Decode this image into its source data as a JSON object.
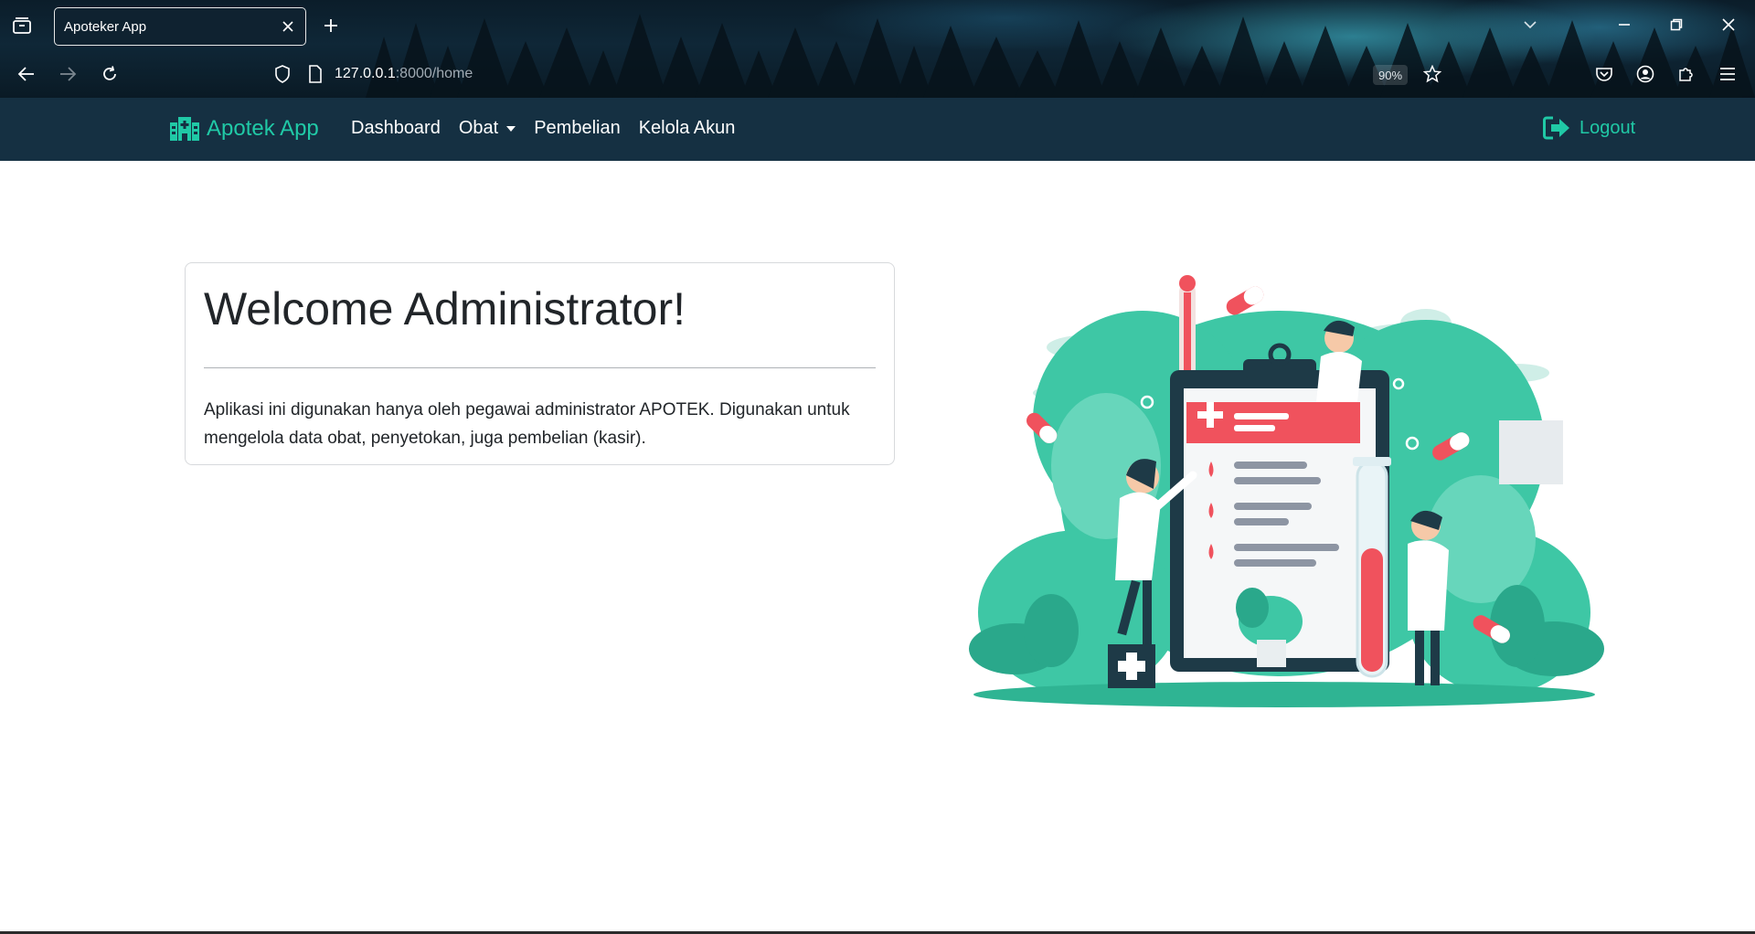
{
  "browser": {
    "tab_title": "Apoteker App",
    "url_host": "127.0.0.1",
    "url_path": ":8000/home",
    "zoom": "90%"
  },
  "app": {
    "brand": "Apotek App",
    "menu": {
      "dashboard": "Dashboard",
      "obat": "Obat",
      "pembelian": "Pembelian",
      "kelola_akun": "Kelola Akun"
    },
    "logout": "Logout"
  },
  "welcome": {
    "title": "Welcome Administrator!",
    "description": "Aplikasi ini digunakan hanya oleh pegawai administrator APOTEK. Digunakan untuk mengelola data obat, penyetokan, juga pembelian (kasir)."
  },
  "colors": {
    "navbar": "#153042",
    "accent": "#20c9a6",
    "illustration_teal": "#3ec7a5",
    "illustration_red": "#f0525d"
  }
}
